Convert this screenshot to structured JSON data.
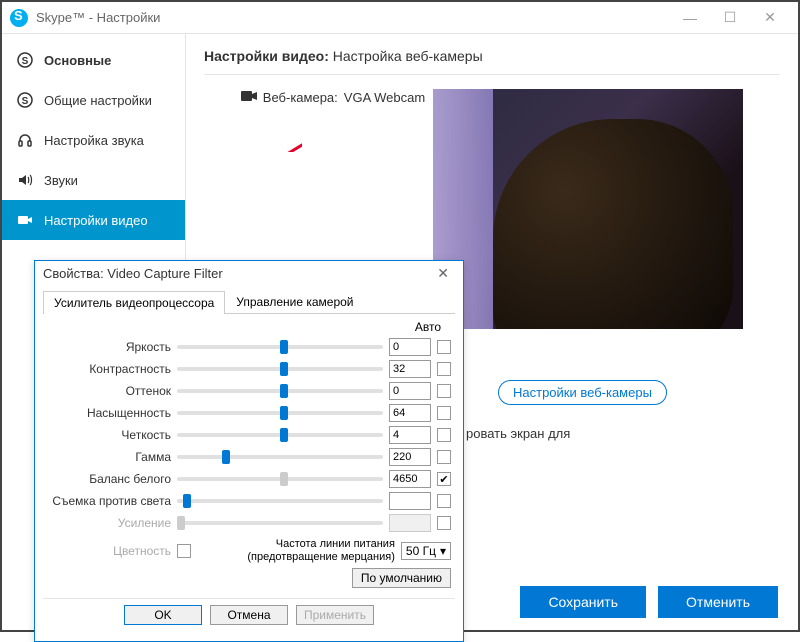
{
  "window": {
    "title": "Skype™ - Настройки"
  },
  "sidebar": {
    "header": "Основные",
    "items": [
      {
        "label": "Общие настройки",
        "icon": "skype"
      },
      {
        "label": "Настройка звука",
        "icon": "headset"
      },
      {
        "label": "Звуки",
        "icon": "speaker"
      },
      {
        "label": "Настройки видео",
        "icon": "camera",
        "active": true
      }
    ]
  },
  "content": {
    "header_prefix": "Настройки видео:",
    "header_sub": "Настройка веб-камеры",
    "webcam_label": "Веб-камера:",
    "webcam_name": "VGA Webcam",
    "cam_settings_btn": "Настройки веб-камеры",
    "truncated": "ровать экран для"
  },
  "dialog": {
    "title": "Свойства: Video Capture Filter",
    "tabs": [
      "Усилитель видеопроцессора",
      "Управление камерой"
    ],
    "auto_header": "Авто",
    "sliders": [
      {
        "label": "Яркость",
        "value": "0",
        "pos": 50,
        "auto": false
      },
      {
        "label": "Контрастность",
        "value": "32",
        "pos": 50,
        "auto": false
      },
      {
        "label": "Оттенок",
        "value": "0",
        "pos": 50,
        "auto": false
      },
      {
        "label": "Насыщенность",
        "value": "64",
        "pos": 50,
        "auto": false
      },
      {
        "label": "Четкость",
        "value": "4",
        "pos": 50,
        "auto": false
      },
      {
        "label": "Гамма",
        "value": "220",
        "pos": 22,
        "auto": false
      },
      {
        "label": "Баланс белого",
        "value": "4650",
        "pos": 50,
        "auto": true,
        "thumb_disabled": true
      },
      {
        "label": "Съемка против света",
        "value": "",
        "pos": 3,
        "auto": false
      },
      {
        "label": "Усиление",
        "value": "",
        "pos": 0,
        "auto": false,
        "disabled": true
      }
    ],
    "color_label": "Цветность",
    "freq_label_l1": "Частота линии питания",
    "freq_label_l2": "(предотвращение мерцания)",
    "freq_value": "50 Гц",
    "defaults_btn": "По умолчанию",
    "buttons": {
      "ok": "OK",
      "cancel": "Отмена",
      "apply": "Применить"
    }
  },
  "footer": {
    "save": "Сохранить",
    "cancel": "Отменить"
  }
}
